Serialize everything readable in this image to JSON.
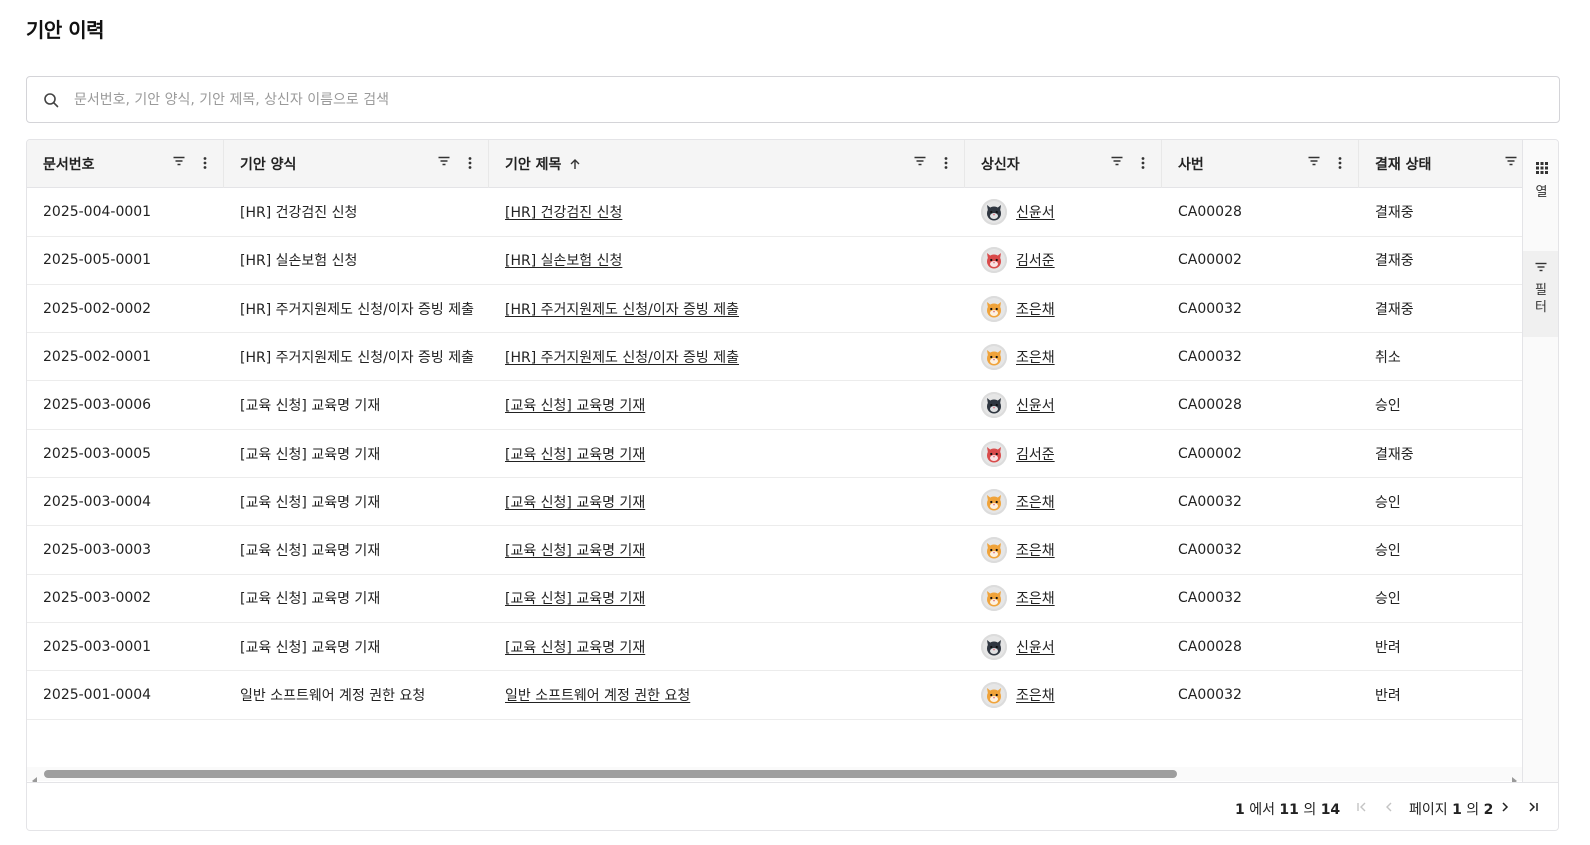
{
  "page": {
    "title": "기안 이력"
  },
  "search": {
    "placeholder": "문서번호, 기안 양식, 기안 제목, 상신자 이름으로 검색"
  },
  "table": {
    "columns": [
      {
        "key": "doc_no",
        "label": "문서번호"
      },
      {
        "key": "form",
        "label": "기안 양식"
      },
      {
        "key": "subject",
        "label": "기안 제목",
        "sort": "asc"
      },
      {
        "key": "submitter",
        "label": "상신자"
      },
      {
        "key": "emp_no",
        "label": "사번"
      },
      {
        "key": "status",
        "label": "결재 상태"
      }
    ],
    "rows": [
      {
        "doc_no": "2025-004-0001",
        "form": "[HR] 건강검진 신청",
        "subject": "[HR] 건강검진 신청",
        "submitter": "신윤서",
        "avatar": "dark-cat-avatar",
        "emp_no": "CA00028",
        "status": "결재중"
      },
      {
        "doc_no": "2025-005-0001",
        "form": "[HR] 실손보험 신청",
        "subject": "[HR] 실손보험 신청",
        "submitter": "김서준",
        "avatar": "red-cat-avatar",
        "emp_no": "CA00002",
        "status": "결재중"
      },
      {
        "doc_no": "2025-002-0002",
        "form": "[HR] 주거지원제도 신청/이자 증빙 제출",
        "subject": "[HR] 주거지원제도 신청/이자 증빙 제출",
        "submitter": "조은채",
        "avatar": "orange-cat-avatar",
        "emp_no": "CA00032",
        "status": "결재중"
      },
      {
        "doc_no": "2025-002-0001",
        "form": "[HR] 주거지원제도 신청/이자 증빙 제출",
        "subject": "[HR] 주거지원제도 신청/이자 증빙 제출",
        "submitter": "조은채",
        "avatar": "orange-cat-avatar",
        "emp_no": "CA00032",
        "status": "취소"
      },
      {
        "doc_no": "2025-003-0006",
        "form": "[교육 신청] 교육명 기재",
        "subject": "[교육 신청] 교육명 기재",
        "submitter": "신윤서",
        "avatar": "dark-cat-avatar",
        "emp_no": "CA00028",
        "status": "승인"
      },
      {
        "doc_no": "2025-003-0005",
        "form": "[교육 신청] 교육명 기재",
        "subject": "[교육 신청] 교육명 기재",
        "submitter": "김서준",
        "avatar": "red-cat-avatar",
        "emp_no": "CA00002",
        "status": "결재중"
      },
      {
        "doc_no": "2025-003-0004",
        "form": "[교육 신청] 교육명 기재",
        "subject": "[교육 신청] 교육명 기재",
        "submitter": "조은채",
        "avatar": "orange-cat-avatar",
        "emp_no": "CA00032",
        "status": "승인"
      },
      {
        "doc_no": "2025-003-0003",
        "form": "[교육 신청] 교육명 기재",
        "subject": "[교육 신청] 교육명 기재",
        "submitter": "조은채",
        "avatar": "orange-cat-avatar",
        "emp_no": "CA00032",
        "status": "승인"
      },
      {
        "doc_no": "2025-003-0002",
        "form": "[교육 신청] 교육명 기재",
        "subject": "[교육 신청] 교육명 기재",
        "submitter": "조은채",
        "avatar": "orange-cat-avatar",
        "emp_no": "CA00032",
        "status": "승인"
      },
      {
        "doc_no": "2025-003-0001",
        "form": "[교육 신청] 교육명 기재",
        "subject": "[교육 신청] 교육명 기재",
        "submitter": "신윤서",
        "avatar": "dark-cat-avatar",
        "emp_no": "CA00028",
        "status": "반려"
      },
      {
        "doc_no": "2025-001-0004",
        "form": "일반 소프트웨어 계정 권한 요청",
        "subject": "일반 소프트웨어 계정 권한 요청",
        "submitter": "조은채",
        "avatar": "orange-cat-avatar",
        "emp_no": "CA00032",
        "status": "반려"
      }
    ]
  },
  "side_panel": {
    "columns_label": "열",
    "filters_label": "필터"
  },
  "pagination": {
    "from": "1",
    "from_suffix": " 에서 ",
    "to": "11",
    "to_suffix": " 의 ",
    "total": "14",
    "page_prefix": "페이지 ",
    "page": "1",
    "page_mid": " 의 ",
    "page_total": "2"
  },
  "avatar_colors": {
    "dark-cat-avatar": "#2f3640",
    "red-cat-avatar": "#d94b4b",
    "orange-cat-avatar": "#f0a33a"
  }
}
